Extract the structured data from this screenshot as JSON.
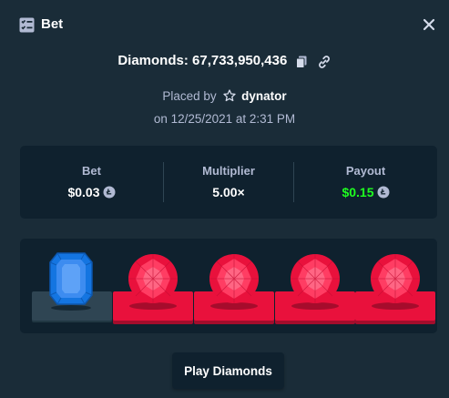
{
  "header": {
    "title": "Bet",
    "title_icon": "bet-slip-icon",
    "close_icon": "close-icon"
  },
  "summary": {
    "game_name": "Diamonds",
    "bet_id": "67,733,950,436",
    "diamonds_label": "Diamonds: 67,733,950,436",
    "copy_icon": "copy-icon",
    "link_icon": "link-icon",
    "placed_by_label": "Placed by",
    "user_icon": "star-icon",
    "username": "dynator",
    "date_label": "on 12/25/2021 at 2:31 PM"
  },
  "stats": {
    "bet_label": "Bet",
    "bet_value": "$0.03",
    "multiplier_label": "Multiplier",
    "multiplier_value": "5.00×",
    "payout_label": "Payout",
    "payout_value": "$0.15",
    "currency_icon": "litecoin-icon"
  },
  "board": {
    "gems": [
      {
        "type": "blue-gem",
        "plate": "grey",
        "color": "#1475e1"
      },
      {
        "type": "red-gem",
        "plate": "red",
        "color": "#e9113c"
      },
      {
        "type": "red-gem",
        "plate": "red",
        "color": "#e9113c"
      },
      {
        "type": "red-gem",
        "plate": "red",
        "color": "#e9113c"
      },
      {
        "type": "red-gem",
        "plate": "red",
        "color": "#e9113c"
      }
    ]
  },
  "actions": {
    "play_label": "Play Diamonds"
  },
  "colors": {
    "background": "#1a2c38",
    "panel": "#0f212e",
    "muted_text": "#b1bad3",
    "payout_green": "#1fff20",
    "red_gem": "#e9113c",
    "blue_gem": "#1475e1"
  }
}
